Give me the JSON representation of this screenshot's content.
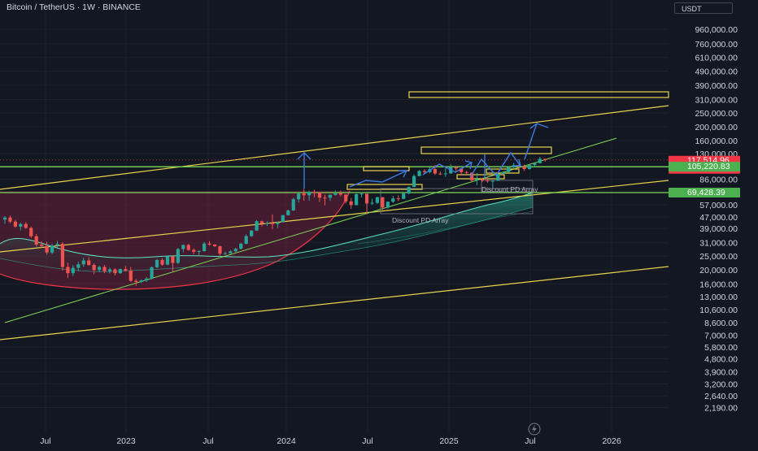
{
  "header": {
    "title": "Bitcoin / TetherUS · 1W · BINANCE"
  },
  "currency": "USDT",
  "chart_data": {
    "type": "candlestick",
    "symbol": "Bitcoin / TetherUS",
    "interval": "1W",
    "exchange": "BINANCE",
    "y_scale": "log",
    "y_tick_labels": [
      "960,000.00",
      "760,000.00",
      "610,000.00",
      "490,000.00",
      "390,000.00",
      "310,000.00",
      "250,000.00",
      "200,000.00",
      "160,000.00",
      "130,000.00",
      "86,000.00",
      "57,000.00",
      "47,000.00",
      "39,000.00",
      "31,000.00",
      "25,000.00",
      "20,000.00",
      "16,000.00",
      "13,000.00",
      "10,600.00",
      "8,600.00",
      "7,000.00",
      "5,800.00",
      "4,800.00",
      "3,900.00",
      "3,200.00",
      "2,640.00",
      "2,190.00"
    ],
    "x_tick_labels": [
      "Jul",
      "2023",
      "Jul",
      "2024",
      "Jul",
      "2025",
      "Jul",
      "2026"
    ],
    "price_tags": [
      {
        "label": "117,514.96",
        "sub": "5d 7h",
        "value": 117514.96,
        "color": "#f23645"
      },
      {
        "label": "105,220.83",
        "value": 105220.83,
        "color": "#4caf50"
      },
      {
        "label": "69,428.39",
        "value": 69428.39,
        "color": "#4caf50"
      }
    ],
    "annotations": [
      "Discount PD Array",
      "Discount PD Array"
    ],
    "horizontal_levels": [
      105220.83,
      69428.39
    ],
    "colors": {
      "up": "#26a69a",
      "down": "#ef5350",
      "channel": "#e8d44d",
      "level": "#7ed957",
      "arrow": "#2962ff",
      "band": "#2ec4a5"
    },
    "series": [
      {
        "name": "",
        "values": [
          [
            45000,
            47500,
            42000,
            46500
          ],
          [
            46500,
            48000,
            42500,
            43500
          ],
          [
            43500,
            44800,
            39500,
            40200
          ],
          [
            40200,
            42600,
            37800,
            41900
          ],
          [
            41900,
            43200,
            38800,
            39300
          ],
          [
            39300,
            40200,
            33500,
            34400
          ],
          [
            34400,
            35600,
            29200,
            30100
          ],
          [
            30100,
            31800,
            28600,
            29400
          ],
          [
            29400,
            31500,
            25600,
            26500
          ],
          [
            26500,
            30500,
            25800,
            29600
          ],
          [
            29600,
            31900,
            28800,
            30400
          ],
          [
            30400,
            31300,
            19800,
            21000
          ],
          [
            21000,
            22500,
            17600,
            19000
          ],
          [
            19000,
            21600,
            18200,
            20700
          ],
          [
            20700,
            22800,
            19600,
            21900
          ],
          [
            21900,
            24300,
            21000,
            23300
          ],
          [
            23300,
            24600,
            21400,
            21700
          ],
          [
            21700,
            22300,
            18700,
            20000
          ],
          [
            20000,
            21400,
            19300,
            21000
          ],
          [
            21000,
            21700,
            19000,
            19600
          ],
          [
            19600,
            20800,
            18900,
            20200
          ],
          [
            20200,
            20600,
            18300,
            19000
          ],
          [
            19000,
            20500,
            18800,
            20300
          ],
          [
            20300,
            21300,
            19500,
            19800
          ],
          [
            19800,
            21000,
            16500,
            16800
          ],
          [
            16800,
            17300,
            15500,
            16500
          ],
          [
            16500,
            17200,
            16200,
            16900
          ],
          [
            16900,
            17900,
            16500,
            17400
          ],
          [
            17400,
            21200,
            17100,
            20900
          ],
          [
            20900,
            23900,
            20600,
            23500
          ],
          [
            23500,
            24200,
            21400,
            21800
          ],
          [
            21800,
            25200,
            21600,
            24900
          ],
          [
            24900,
            25000,
            19600,
            22400
          ],
          [
            22400,
            28500,
            22000,
            28000
          ],
          [
            28000,
            30100,
            26600,
            29900
          ],
          [
            29900,
            30500,
            27200,
            27600
          ],
          [
            27600,
            28300,
            25800,
            26800
          ],
          [
            26800,
            27500,
            25400,
            27100
          ],
          [
            27100,
            31400,
            26800,
            30600
          ],
          [
            30600,
            31800,
            29500,
            30100
          ],
          [
            30100,
            30300,
            28900,
            29300
          ],
          [
            29300,
            29600,
            25200,
            26000
          ],
          [
            26000,
            26900,
            25400,
            26200
          ],
          [
            26200,
            27500,
            25800,
            27000
          ],
          [
            27000,
            28600,
            26600,
            28100
          ],
          [
            28100,
            31000,
            27800,
            30500
          ],
          [
            30500,
            35500,
            30200,
            34500
          ],
          [
            34500,
            38000,
            34000,
            37700
          ],
          [
            37700,
            44600,
            37500,
            43800
          ],
          [
            43800,
            44200,
            40300,
            42300
          ],
          [
            42300,
            43800,
            40500,
            42600
          ],
          [
            42600,
            48900,
            38500,
            41900
          ],
          [
            41900,
            43300,
            39300,
            43100
          ],
          [
            43100,
            48500,
            42800,
            48300
          ],
          [
            48300,
            52800,
            48000,
            52100
          ],
          [
            52100,
            63900,
            51700,
            62400
          ],
          [
            62400,
            69000,
            59000,
            68300
          ],
          [
            68300,
            73800,
            60800,
            66500
          ],
          [
            66500,
            71700,
            60800,
            70100
          ],
          [
            70100,
            72700,
            64500,
            69600
          ],
          [
            69600,
            70300,
            59600,
            64000
          ],
          [
            64000,
            67000,
            56500,
            63900
          ],
          [
            63900,
            67200,
            60700,
            67000
          ],
          [
            67000,
            71900,
            66000,
            68700
          ],
          [
            68700,
            71600,
            65300,
            67200
          ],
          [
            67200,
            67500,
            58400,
            60300
          ],
          [
            60300,
            63800,
            53500,
            56800
          ],
          [
            56800,
            68400,
            56500,
            67700
          ],
          [
            67700,
            70000,
            64200,
            68200
          ],
          [
            68200,
            68300,
            49000,
            58200
          ],
          [
            58200,
            62800,
            57000,
            58900
          ],
          [
            58900,
            65000,
            57800,
            64400
          ],
          [
            64400,
            64800,
            52500,
            54600
          ],
          [
            54600,
            60300,
            53600,
            59900
          ],
          [
            59900,
            65900,
            58900,
            63200
          ],
          [
            63200,
            66400,
            60500,
            62800
          ],
          [
            62800,
            69200,
            62300,
            68400
          ],
          [
            68400,
            76500,
            67600,
            76000
          ],
          [
            76000,
            93200,
            75800,
            90600
          ],
          [
            90600,
            99800,
            90000,
            98200
          ],
          [
            98200,
            101500,
            94000,
            96500
          ],
          [
            96500,
            104100,
            94800,
            101500
          ],
          [
            101500,
            108300,
            92200,
            94300
          ],
          [
            94300,
            97400,
            92000,
            93700
          ],
          [
            93700,
            102700,
            89300,
            94500
          ],
          [
            94500,
            109500,
            93900,
            104500
          ],
          [
            104500,
            106600,
            96100,
            102400
          ],
          [
            102400,
            103000,
            91200,
            96500
          ],
          [
            96500,
            98500,
            91200,
            95700
          ],
          [
            95700,
            96000,
            82100,
            84500
          ],
          [
            84500,
            95000,
            78200,
            86100
          ],
          [
            86100,
            87500,
            82000,
            84300
          ],
          [
            84300,
            88700,
            81300,
            83500
          ],
          [
            83500,
            84700,
            74500,
            84000
          ],
          [
            84000,
            94500,
            83800,
            93800
          ],
          [
            93800,
            97900,
            92700,
            96500
          ],
          [
            96500,
            105800,
            95800,
            104200
          ],
          [
            104200,
            111900,
            102800,
            107800
          ],
          [
            107800,
            110700,
            100400,
            105700
          ],
          [
            105700,
            108900,
            98200,
            101400
          ],
          [
            101400,
            108500,
            100800,
            108300
          ],
          [
            108300,
            112000,
            105200,
            111300
          ],
          [
            111300,
            123200,
            110600,
            119500
          ],
          [
            119500,
            120200,
            114500,
            117500
          ]
        ]
      }
    ]
  }
}
